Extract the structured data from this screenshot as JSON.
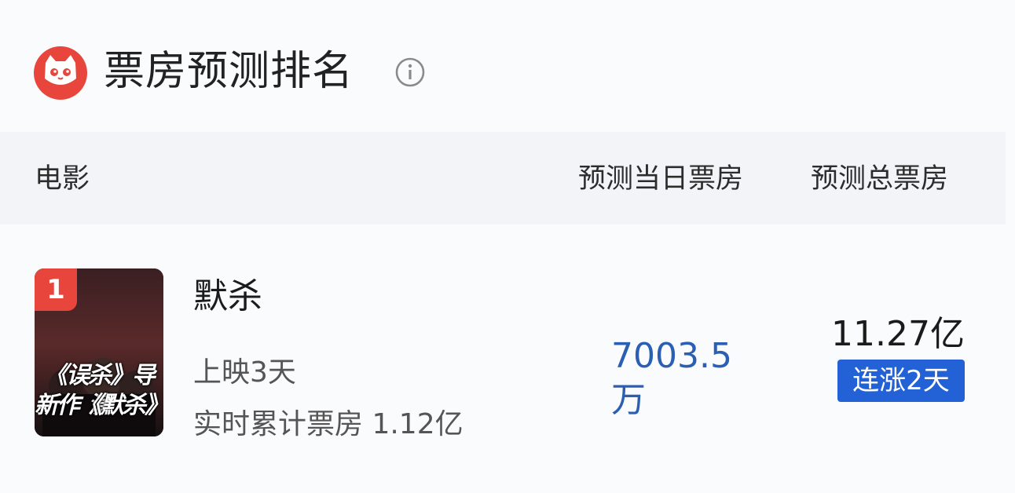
{
  "header": {
    "title": "票房预测排名",
    "logo_icon": "maoyan-cat-logo",
    "info_icon": "info-icon"
  },
  "columns": {
    "movie": "电影",
    "day_forecast": "预测当日票房",
    "total_forecast": "预测总票房"
  },
  "rows": [
    {
      "rank": "1",
      "title": "默杀",
      "poster_line1": "《误杀》导演",
      "poster_line2": "新作《默杀》",
      "poster_sign": "默杀",
      "days_text": "上映3天",
      "cumulative_text": "实时累计票房 1.12亿",
      "day_box_office": "7003.5万",
      "total_box_office": "11.27亿",
      "streak_badge": "连涨2天"
    }
  ],
  "colors": {
    "brand_red": "#e8453c",
    "accent_blue": "#2262d6",
    "value_blue": "#2b5fb3",
    "header_bg": "#f2f4f7"
  }
}
